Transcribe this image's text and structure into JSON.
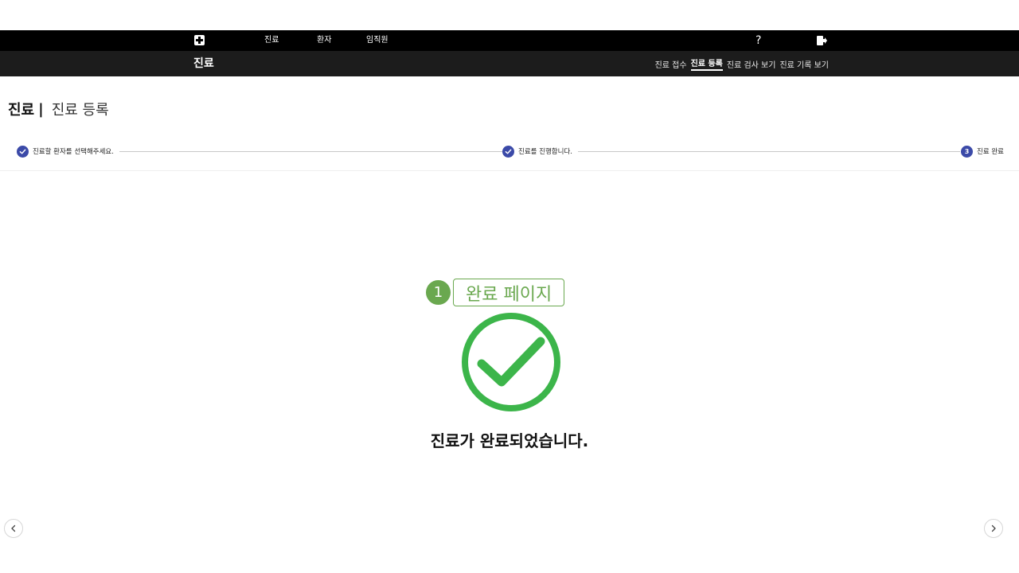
{
  "topbar": {
    "logo_icon": "medical-cross-icon",
    "menu": [
      "진료",
      "환자",
      "임직원"
    ],
    "help_label": "?",
    "logout_icon": "logout-icon"
  },
  "subbar": {
    "section_title": "진료",
    "nav": [
      "진료 접수",
      "진료 등록",
      "진료 검사 보기",
      "진료 기록 보기"
    ],
    "active_nav": "진료 등록"
  },
  "heading": {
    "main": "진료",
    "separator": "|",
    "sub": "진료 등록"
  },
  "stepper": {
    "steps": [
      {
        "label": "진료할 환자를 선택해주세요.",
        "state": "done",
        "icon": "check-icon"
      },
      {
        "label": "진료를 진행합니다.",
        "state": "done",
        "icon": "check-icon"
      },
      {
        "label": "진료 완료",
        "state": "current",
        "number": "3"
      }
    ],
    "accent_color": "#3b4aa8"
  },
  "annotation": {
    "number": "1",
    "label": "완료 페이지",
    "color": "#6aa84f"
  },
  "result": {
    "icon": "check-circle-icon",
    "icon_color": "#3cb54a",
    "message": "진료가 완료되었습니다."
  },
  "nav_arrows": {
    "prev_icon": "chevron-left-icon",
    "next_icon": "chevron-right-icon"
  }
}
